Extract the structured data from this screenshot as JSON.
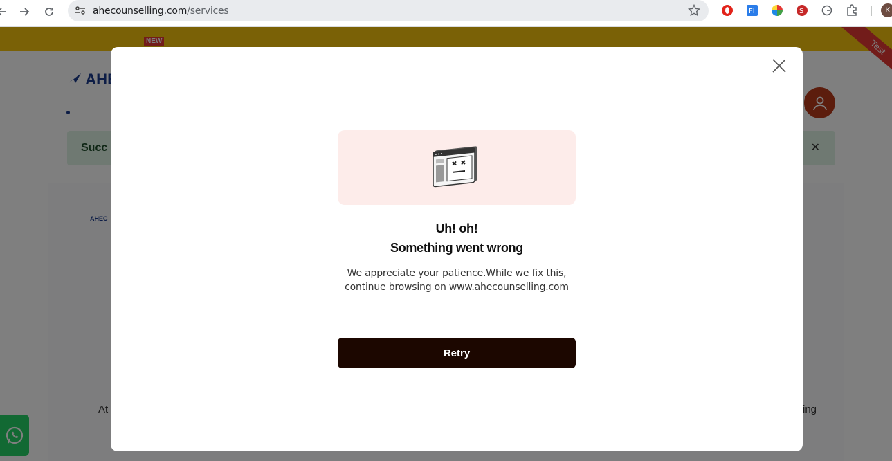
{
  "browser": {
    "url_domain": "ahecounselling.com",
    "url_path": "/services",
    "profile_initial": "K"
  },
  "page": {
    "new_badge": "NEW",
    "logo_text": "AHE",
    "ribbon_text": "Test",
    "success_text": "Succ",
    "success_close": "✕",
    "mini_logo": "AHEC",
    "body_left": "At",
    "body_right": "ing"
  },
  "modal": {
    "title_line1": "Uh! oh!",
    "title_line2": "Something went wrong",
    "message_line1": "We appreciate your patience.While we fix this,",
    "message_line2": "continue browsing on www.ahecounselling.com",
    "retry_label": "Retry"
  },
  "colors": {
    "overlay": "rgba(0,0,0,0.5)",
    "retry_button": "#1c0700",
    "illustration_bg": "#fdecea",
    "promo_bar": "#f4c20d"
  },
  "icons": {
    "back": "back-arrow-icon",
    "forward": "forward-arrow-icon",
    "reload": "reload-icon",
    "site_info": "site-info-icon",
    "bookmark": "star-icon",
    "close": "close-icon",
    "error_browser": "broken-browser-window-icon",
    "user": "user-icon",
    "whatsapp": "whatsapp-icon"
  }
}
